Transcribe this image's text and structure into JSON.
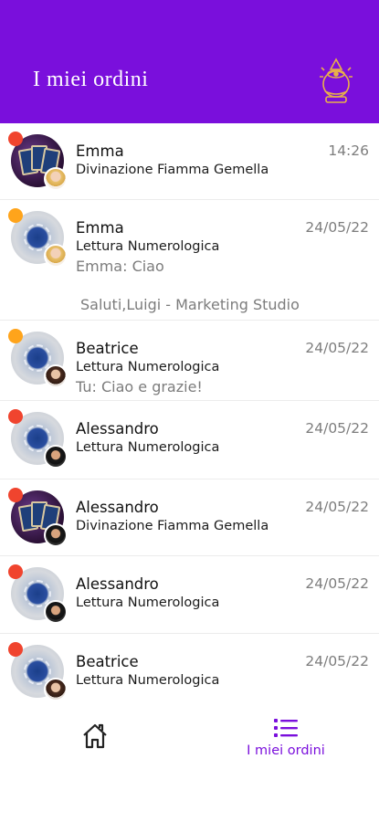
{
  "header": {
    "title": "I miei ordini",
    "logo_icon": "crystal-ball-eye-icon"
  },
  "colors": {
    "primary": "#7a0fdc",
    "status_red": "#f0442e",
    "status_orange": "#ffa41b"
  },
  "orders": [
    {
      "name": "Emma",
      "service": "Divinazione Fiamma Gemella",
      "time": "14:26",
      "preview": "",
      "preview2": "",
      "status": "red",
      "service_image": "tarot-cards",
      "user_avatar": "emma"
    },
    {
      "name": "Emma",
      "service": "Lettura Numerologica",
      "time": "24/05/22",
      "preview": "Emma: Ciao",
      "preview2": "Saluti,Luigi - Marketing Studio",
      "status": "orange",
      "service_image": "numerology-wheel",
      "user_avatar": "emma"
    },
    {
      "name": "Beatrice",
      "service": "Lettura Numerologica",
      "time": "24/05/22",
      "preview": "Tu: Ciao e grazie!",
      "preview2": "",
      "status": "orange",
      "service_image": "numerology-wheel",
      "user_avatar": "beatrice"
    },
    {
      "name": "Alessandro",
      "service": "Lettura Numerologica",
      "time": "24/05/22",
      "preview": "",
      "preview2": "",
      "status": "red",
      "service_image": "numerology-wheel",
      "user_avatar": "alessandro"
    },
    {
      "name": "Alessandro",
      "service": "Divinazione Fiamma Gemella",
      "time": "24/05/22",
      "preview": "",
      "preview2": "",
      "status": "red",
      "service_image": "tarot-cards",
      "user_avatar": "alessandro"
    },
    {
      "name": "Alessandro",
      "service": "Lettura Numerologica",
      "time": "24/05/22",
      "preview": "",
      "preview2": "",
      "status": "red",
      "service_image": "numerology-wheel",
      "user_avatar": "alessandro"
    },
    {
      "name": "Beatrice",
      "service": "Lettura Numerologica",
      "time": "24/05/22",
      "preview": "",
      "preview2": "",
      "status": "red",
      "service_image": "numerology-wheel",
      "user_avatar": "beatrice"
    }
  ],
  "bottom_nav": {
    "home_icon": "home-icon",
    "orders_icon": "list-icon",
    "orders_label": "I miei ordini"
  }
}
